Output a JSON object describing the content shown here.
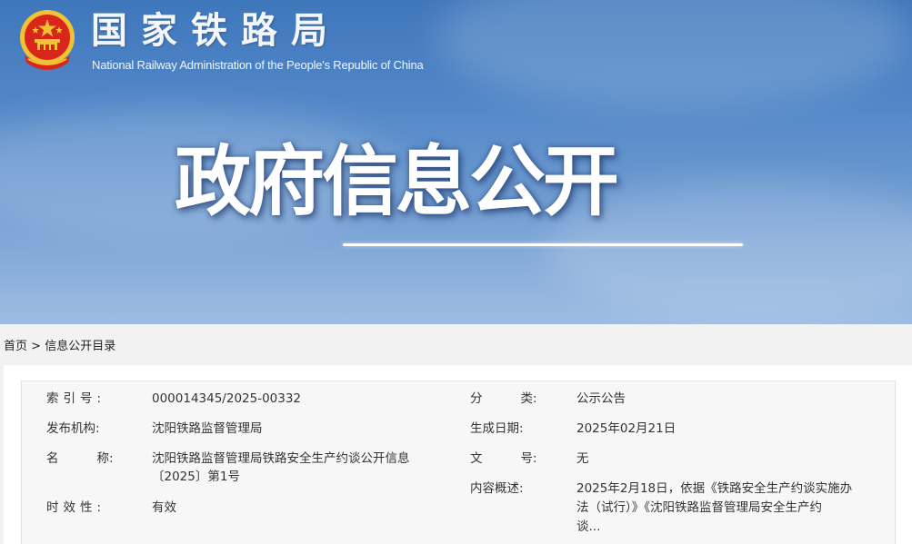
{
  "header": {
    "site_title": "国家铁路局",
    "site_subtitle": "National Railway Administration of the People's Republic of China"
  },
  "hero": {
    "title": "政府信息公开"
  },
  "breadcrumb": {
    "home": "首页",
    "separator": ">",
    "current": "信息公开目录"
  },
  "info": {
    "index_no": {
      "label": "索引号:",
      "value": "000014345/2025-00332"
    },
    "category": {
      "label_a": "分",
      "label_b": "类:",
      "value": "公示公告"
    },
    "publisher": {
      "label": "发布机构:",
      "value": "沈阳铁路监督管理局"
    },
    "created_date": {
      "label": "生成日期:",
      "value": "2025年02月21日"
    },
    "name": {
      "label_a": "名",
      "label_b": "称:",
      "value_line1": "沈阳铁路监督管理局铁路安全生产约谈公开信息",
      "value_line2": "〔2025〕第1号"
    },
    "doc_no": {
      "label_a": "文",
      "label_b": "号:",
      "value": "无"
    },
    "summary": {
      "label": "内容概述:",
      "value_line1": "2025年2月18日，依据《铁路安全生产约谈实施办",
      "value_line2": "法（试行）》《沈阳铁路监督管理局安全生产约",
      "value_line3": "谈..."
    },
    "validity": {
      "label": "时效性:",
      "value": "有效"
    }
  },
  "colors": {
    "banner_top": "#3f77bc",
    "banner_bottom": "#9dbde2",
    "page_bg": "#f2f2f2",
    "emblem_red": "#d8261c",
    "emblem_gold": "#f1c232"
  }
}
